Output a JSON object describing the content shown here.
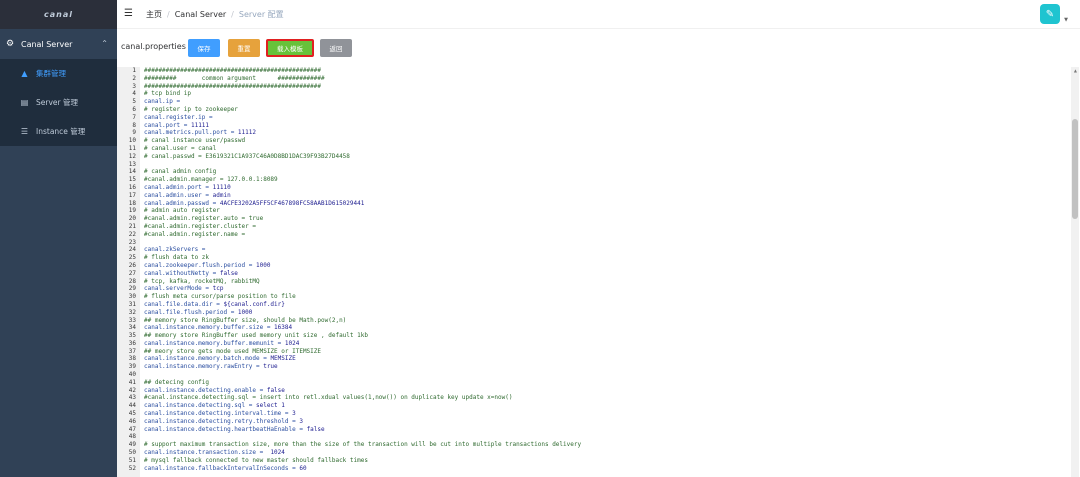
{
  "app": {
    "logo": "canal"
  },
  "sidebar": {
    "group_label": "Canal Server",
    "items": [
      {
        "label": "集群管理",
        "active": true
      },
      {
        "label": "Server 管理",
        "active": false
      },
      {
        "label": "Instance 管理",
        "active": false
      }
    ]
  },
  "breadcrumb": {
    "home": "主页",
    "middle": "Canal Server",
    "current": "Server 配置"
  },
  "toolbar": {
    "file_label": "canal.properties",
    "save_label": "保存",
    "reset_label": "重置",
    "template_label": "载入模板",
    "back_label": "返回"
  },
  "colors": {
    "sidebar": "#304156",
    "accent": "#409eff",
    "save": "#409eff",
    "reset": "#e6a23c",
    "template": "#67c23a",
    "back": "#909399"
  },
  "editor": {
    "lines": [
      {
        "n": "1",
        "t": "#################################################",
        "k": "c"
      },
      {
        "n": "2",
        "t": "#########       common argument      #############",
        "k": "c"
      },
      {
        "n": "3",
        "t": "#################################################",
        "k": "c"
      },
      {
        "n": "4",
        "t": "# tcp bind ip",
        "k": "c"
      },
      {
        "n": "5",
        "t": "canal.ip =",
        "k": "k"
      },
      {
        "n": "6",
        "t": "# register ip to zookeeper",
        "k": "c"
      },
      {
        "n": "7",
        "t": "canal.register.ip =",
        "k": "k"
      },
      {
        "n": "8",
        "t": "canal.port = 11111",
        "k": "k"
      },
      {
        "n": "9",
        "t": "canal.metrics.pull.port = 11112",
        "k": "k"
      },
      {
        "n": "10",
        "t": "# canal instance user/passwd",
        "k": "c"
      },
      {
        "n": "11",
        "t": "# canal.user = canal",
        "k": "c"
      },
      {
        "n": "12",
        "t": "# canal.passwd = E3619321C1A937C46A0D8BD1DAC39F93B27D4458",
        "k": "c"
      },
      {
        "n": "13",
        "t": "",
        "k": "c"
      },
      {
        "n": "14",
        "t": "# canal admin config",
        "k": "c"
      },
      {
        "n": "15",
        "t": "#canal.admin.manager = 127.0.0.1:8089",
        "k": "c"
      },
      {
        "n": "16",
        "t": "canal.admin.port = 11110",
        "k": "k"
      },
      {
        "n": "17",
        "t": "canal.admin.user = admin",
        "k": "k"
      },
      {
        "n": "18",
        "t": "canal.admin.passwd = 4ACFE3202A5FF5CF467898FC58AAB1D615029441",
        "k": "k"
      },
      {
        "n": "19",
        "t": "# admin auto register",
        "k": "c"
      },
      {
        "n": "20",
        "t": "#canal.admin.register.auto = true",
        "k": "c"
      },
      {
        "n": "21",
        "t": "#canal.admin.register.cluster =",
        "k": "c"
      },
      {
        "n": "22",
        "t": "#canal.admin.register.name =",
        "k": "c"
      },
      {
        "n": "23",
        "t": "",
        "k": "c"
      },
      {
        "n": "24",
        "t": "canal.zkServers =",
        "k": "k"
      },
      {
        "n": "25",
        "t": "# flush data to zk",
        "k": "c"
      },
      {
        "n": "26",
        "t": "canal.zookeeper.flush.period = 1000",
        "k": "k"
      },
      {
        "n": "27",
        "t": "canal.withoutNetty = false",
        "k": "k"
      },
      {
        "n": "28",
        "t": "# tcp, kafka, rocketMQ, rabbitMQ",
        "k": "c"
      },
      {
        "n": "29",
        "t": "canal.serverMode = tcp",
        "k": "k"
      },
      {
        "n": "30",
        "t": "# flush meta cursor/parse position to file",
        "k": "c"
      },
      {
        "n": "31",
        "t": "canal.file.data.dir = ${canal.conf.dir}",
        "k": "k"
      },
      {
        "n": "32",
        "t": "canal.file.flush.period = 1000",
        "k": "k"
      },
      {
        "n": "33",
        "t": "## memory store RingBuffer size, should be Math.pow(2,n)",
        "k": "c"
      },
      {
        "n": "34",
        "t": "canal.instance.memory.buffer.size = 16384",
        "k": "k"
      },
      {
        "n": "35",
        "t": "## memory store RingBuffer used memory unit size , default 1kb",
        "k": "c"
      },
      {
        "n": "36",
        "t": "canal.instance.memory.buffer.memunit = 1024",
        "k": "k"
      },
      {
        "n": "37",
        "t": "## meory store gets mode used MEMSIZE or ITEMSIZE",
        "k": "c"
      },
      {
        "n": "38",
        "t": "canal.instance.memory.batch.mode = MEMSIZE",
        "k": "k"
      },
      {
        "n": "39",
        "t": "canal.instance.memory.rawEntry = true",
        "k": "k"
      },
      {
        "n": "40",
        "t": "",
        "k": "c"
      },
      {
        "n": "41",
        "t": "## detecing config",
        "k": "c"
      },
      {
        "n": "42",
        "t": "canal.instance.detecting.enable = false",
        "k": "k"
      },
      {
        "n": "43",
        "t": "#canal.instance.detecting.sql = insert into retl.xdual values(1,now()) on duplicate key update x=now()",
        "k": "c"
      },
      {
        "n": "44",
        "t": "canal.instance.detecting.sql = select 1",
        "k": "k"
      },
      {
        "n": "45",
        "t": "canal.instance.detecting.interval.time = 3",
        "k": "k"
      },
      {
        "n": "46",
        "t": "canal.instance.detecting.retry.threshold = 3",
        "k": "k"
      },
      {
        "n": "47",
        "t": "canal.instance.detecting.heartbeatHaEnable = false",
        "k": "k"
      },
      {
        "n": "48",
        "t": "",
        "k": "c"
      },
      {
        "n": "49",
        "t": "# support maximum transaction size, more than the size of the transaction will be cut into multiple transactions delivery",
        "k": "c"
      },
      {
        "n": "50",
        "t": "canal.instance.transaction.size =  1024",
        "k": "k"
      },
      {
        "n": "51",
        "t": "# mysql fallback connected to new master should fallback times",
        "k": "c"
      },
      {
        "n": "52",
        "t": "canal.instance.fallbackIntervalInSeconds = 60",
        "k": "k"
      }
    ]
  }
}
